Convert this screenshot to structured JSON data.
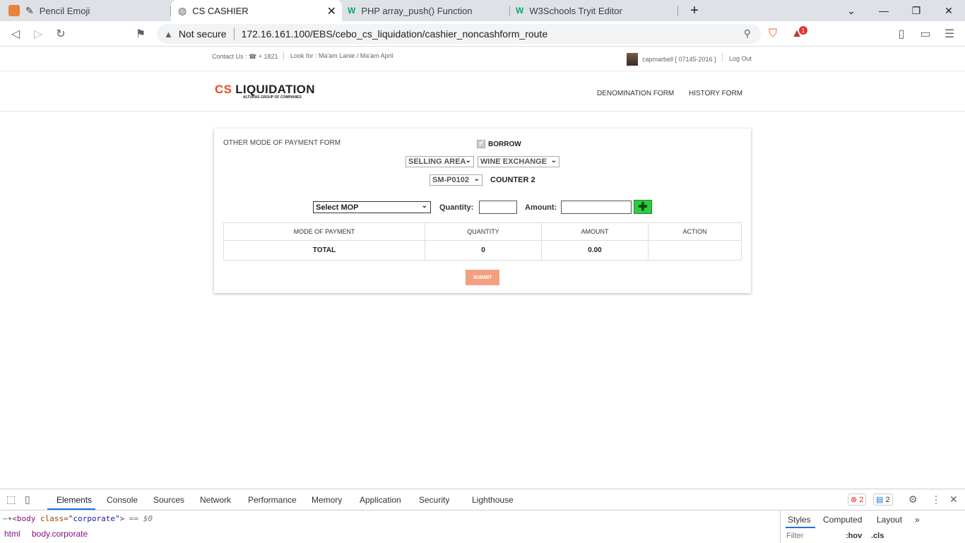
{
  "browser": {
    "tabs": [
      {
        "title": "Pencil Emoji",
        "active": false
      },
      {
        "title": "CS CASHIER",
        "active": true
      },
      {
        "title": "PHP array_push() Function",
        "active": false
      },
      {
        "title": "W3Schools Tryit Editor",
        "active": false
      }
    ],
    "new_tab": "+",
    "security_label": "Not secure",
    "url": "172.16.161.100/EBS/cebo_cs_liquidation/cashier_noncashform_route",
    "notification_count": "1"
  },
  "topbar": {
    "contact": "Contact Us :  ☎  + 1821",
    "look_for": "Look for : Ma'am Lanie / Ma'am April",
    "user": "capmarbell [ 07145-2016 ]",
    "logout": "Log Out"
  },
  "navbar": {
    "logo_prefix": "CS",
    "logo_main": " LIQUIDATION",
    "logo_sub": "ALTURAS GROUP OF COMPANIES",
    "links": [
      "DENOMINATION FORM",
      "HISTORY FORM"
    ]
  },
  "form": {
    "title": "OTHER MODE OF PAYMENT FORM",
    "borrow_label": "BORROW",
    "area_select": "SELLING AREA",
    "section_select": "WINE EXCHANGE",
    "terminal_select": "SM-P0102",
    "counter": "COUNTER 2",
    "mop_select": "Select MOP",
    "quantity_label": "Quantity:",
    "amount_label": "Amount:",
    "table": {
      "headers": [
        "MODE OF PAYMENT",
        "QUANTITY",
        "AMOUNT",
        "ACTION"
      ],
      "total_row": [
        "TOTAL",
        "0",
        "0.00",
        ""
      ]
    },
    "submit_label": "SUBMIT"
  },
  "devtools": {
    "tabs": [
      "Elements",
      "Console",
      "Sources",
      "Network",
      "Performance",
      "Memory",
      "Application",
      "Security",
      "Lighthouse"
    ],
    "errors": "2",
    "messages": "2",
    "dom_line_tag": "<body ",
    "dom_line_attr": "class=",
    "dom_line_val": "\"corporate\"",
    "dom_line_end": ">",
    "dom_line_ref": " == $0",
    "breadcrumbs": [
      "html",
      "body.corporate"
    ],
    "side_tabs": [
      "Styles",
      "Computed",
      "Layout"
    ],
    "filter_placeholder": "Filter",
    "hov": ":hov",
    "cls": ".cls"
  }
}
